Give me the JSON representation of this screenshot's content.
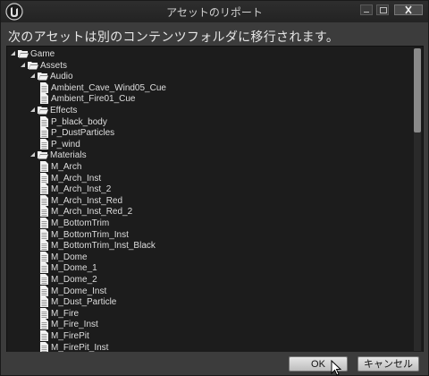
{
  "window": {
    "title": "アセットのリポート"
  },
  "message": "次のアセットは別のコンテンツフォルダに移行されます。",
  "tree": [
    {
      "label": "Game",
      "kind": "folder",
      "depth": 0,
      "expanded": true
    },
    {
      "label": "Assets",
      "kind": "folder",
      "depth": 1,
      "expanded": true
    },
    {
      "label": "Audio",
      "kind": "folder",
      "depth": 2,
      "expanded": true
    },
    {
      "label": "Ambient_Cave_Wind05_Cue",
      "kind": "file",
      "depth": 3
    },
    {
      "label": "Ambient_Fire01_Cue",
      "kind": "file",
      "depth": 3
    },
    {
      "label": "Effects",
      "kind": "folder",
      "depth": 2,
      "expanded": true
    },
    {
      "label": "P_black_body",
      "kind": "file",
      "depth": 3
    },
    {
      "label": "P_DustParticles",
      "kind": "file",
      "depth": 3
    },
    {
      "label": "P_wind",
      "kind": "file",
      "depth": 3
    },
    {
      "label": "Materials",
      "kind": "folder",
      "depth": 2,
      "expanded": true
    },
    {
      "label": "M_Arch",
      "kind": "file",
      "depth": 3
    },
    {
      "label": "M_Arch_Inst",
      "kind": "file",
      "depth": 3
    },
    {
      "label": "M_Arch_Inst_2",
      "kind": "file",
      "depth": 3
    },
    {
      "label": "M_Arch_Inst_Red",
      "kind": "file",
      "depth": 3
    },
    {
      "label": "M_Arch_Inst_Red_2",
      "kind": "file",
      "depth": 3
    },
    {
      "label": "M_BottomTrim",
      "kind": "file",
      "depth": 3
    },
    {
      "label": "M_BottomTrim_Inst",
      "kind": "file",
      "depth": 3
    },
    {
      "label": "M_BottomTrim_Inst_Black",
      "kind": "file",
      "depth": 3
    },
    {
      "label": "M_Dome",
      "kind": "file",
      "depth": 3
    },
    {
      "label": "M_Dome_1",
      "kind": "file",
      "depth": 3
    },
    {
      "label": "M_Dome_2",
      "kind": "file",
      "depth": 3
    },
    {
      "label": "M_Dome_Inst",
      "kind": "file",
      "depth": 3
    },
    {
      "label": "M_Dust_Particle",
      "kind": "file",
      "depth": 3
    },
    {
      "label": "M_Fire",
      "kind": "file",
      "depth": 3
    },
    {
      "label": "M_Fire_Inst",
      "kind": "file",
      "depth": 3
    },
    {
      "label": "M_FirePit",
      "kind": "file",
      "depth": 3
    },
    {
      "label": "M_FirePit_Inst",
      "kind": "file",
      "depth": 3
    }
  ],
  "buttons": {
    "ok": "OK",
    "cancel": "キャンセル"
  },
  "icons": {
    "logo": "unreal-logo-icon",
    "minimize": "minimize-icon",
    "maximize": "maximize-icon",
    "close": "close-icon",
    "folder": "folder-open-icon",
    "file": "file-icon",
    "cursor": "mouse-pointer-icon"
  }
}
